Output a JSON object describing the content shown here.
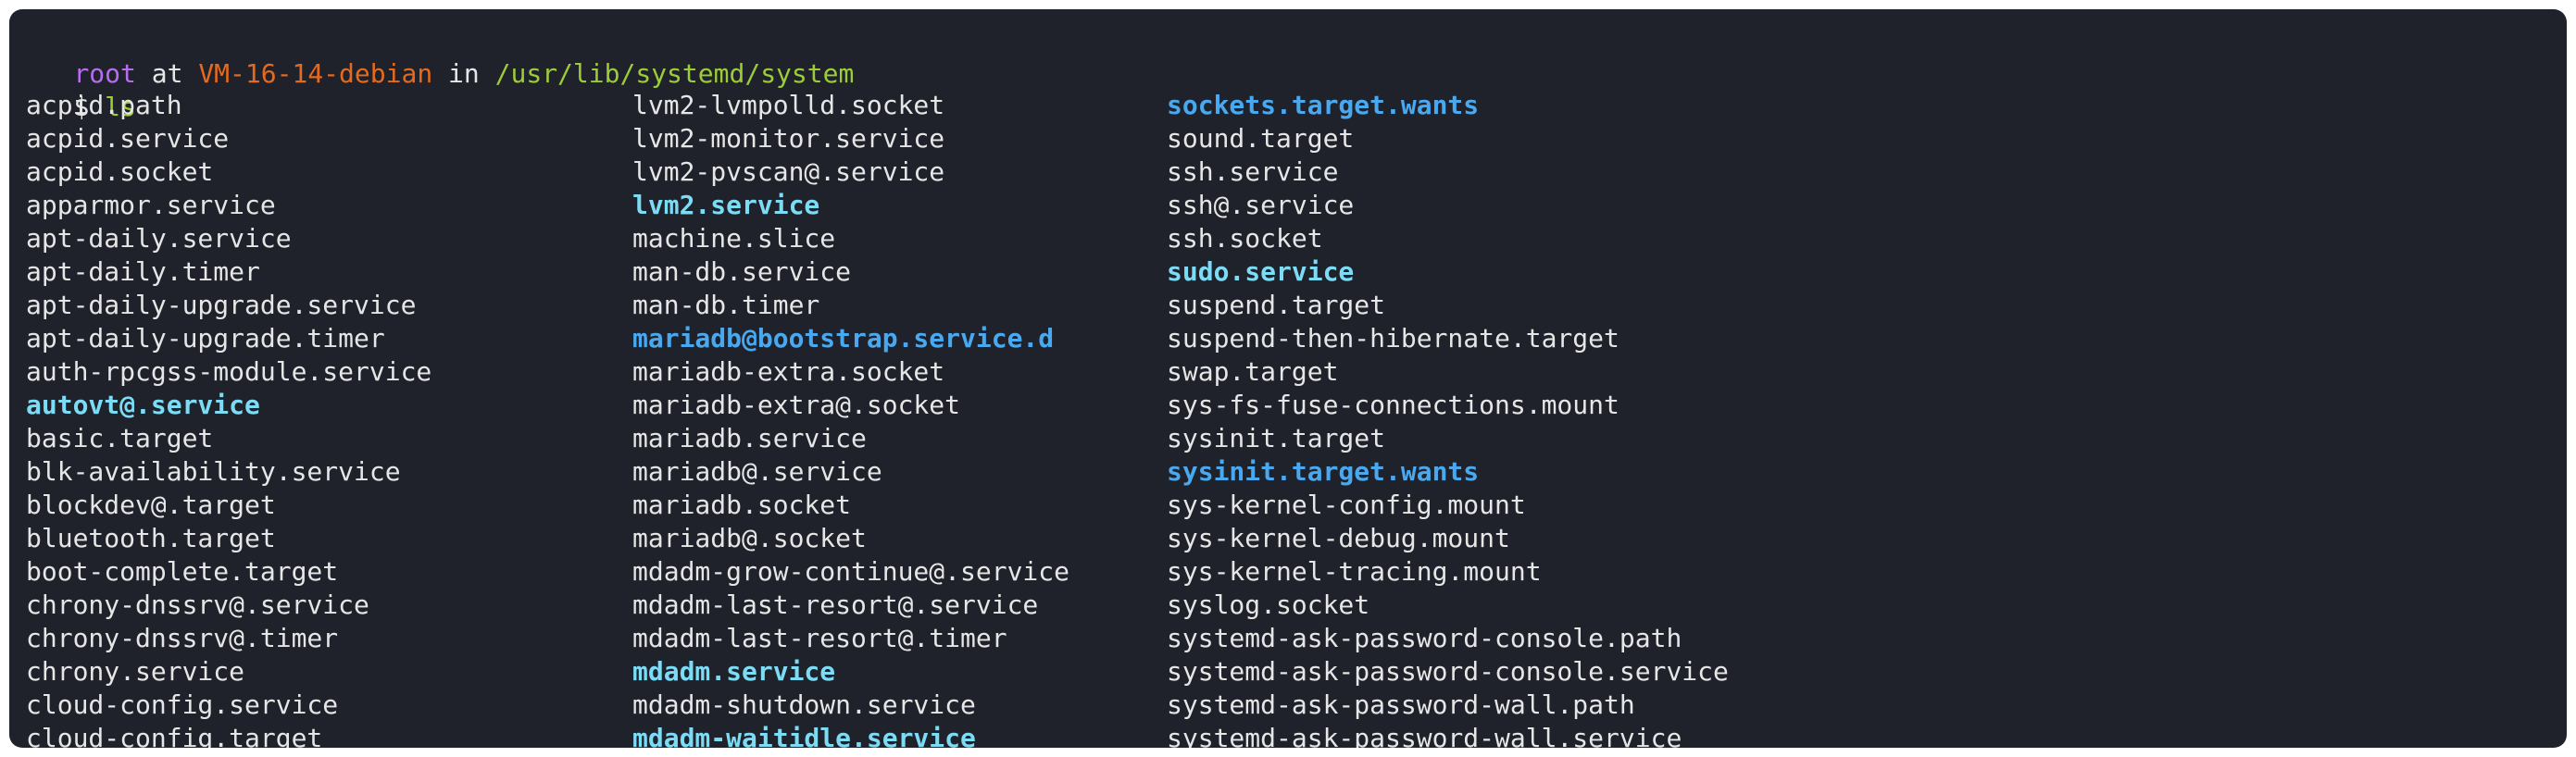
{
  "prompt": {
    "user": "root",
    "at": " at ",
    "host": "VM-16-14-debian",
    "in": " in ",
    "cwd": "/usr/lib/systemd/system",
    "symbol": "$ ",
    "command": "ls"
  },
  "colors": {
    "background": "#1f222b",
    "user": "#b86cf0",
    "host": "#e46a1f",
    "path": "#9ccc38",
    "text": "#e6e6e6",
    "highlight_file": "#7ddcf5",
    "directory": "#49a9f0"
  },
  "listing": {
    "col1": [
      {
        "name": "acpid.path",
        "kind": "file"
      },
      {
        "name": "acpid.service",
        "kind": "file"
      },
      {
        "name": "acpid.socket",
        "kind": "file"
      },
      {
        "name": "apparmor.service",
        "kind": "file"
      },
      {
        "name": "apt-daily.service",
        "kind": "file"
      },
      {
        "name": "apt-daily.timer",
        "kind": "file"
      },
      {
        "name": "apt-daily-upgrade.service",
        "kind": "file"
      },
      {
        "name": "apt-daily-upgrade.timer",
        "kind": "file"
      },
      {
        "name": "auth-rpcgss-module.service",
        "kind": "file"
      },
      {
        "name": "autovt@.service",
        "kind": "link"
      },
      {
        "name": "basic.target",
        "kind": "file"
      },
      {
        "name": "blk-availability.service",
        "kind": "file"
      },
      {
        "name": "blockdev@.target",
        "kind": "file"
      },
      {
        "name": "bluetooth.target",
        "kind": "file"
      },
      {
        "name": "boot-complete.target",
        "kind": "file"
      },
      {
        "name": "chrony-dnssrv@.service",
        "kind": "file"
      },
      {
        "name": "chrony-dnssrv@.timer",
        "kind": "file"
      },
      {
        "name": "chrony.service",
        "kind": "file"
      },
      {
        "name": "cloud-config.service",
        "kind": "file"
      },
      {
        "name": "cloud-config.target",
        "kind": "file"
      }
    ],
    "col2": [
      {
        "name": "lvm2-lvmpolld.socket",
        "kind": "file"
      },
      {
        "name": "lvm2-monitor.service",
        "kind": "file"
      },
      {
        "name": "lvm2-pvscan@.service",
        "kind": "file"
      },
      {
        "name": "lvm2.service",
        "kind": "link"
      },
      {
        "name": "machine.slice",
        "kind": "file"
      },
      {
        "name": "man-db.service",
        "kind": "file"
      },
      {
        "name": "man-db.timer",
        "kind": "file"
      },
      {
        "name": "mariadb@bootstrap.service.d",
        "kind": "dir"
      },
      {
        "name": "mariadb-extra.socket",
        "kind": "file"
      },
      {
        "name": "mariadb-extra@.socket",
        "kind": "file"
      },
      {
        "name": "mariadb.service",
        "kind": "file"
      },
      {
        "name": "mariadb@.service",
        "kind": "file"
      },
      {
        "name": "mariadb.socket",
        "kind": "file"
      },
      {
        "name": "mariadb@.socket",
        "kind": "file"
      },
      {
        "name": "mdadm-grow-continue@.service",
        "kind": "file"
      },
      {
        "name": "mdadm-last-resort@.service",
        "kind": "file"
      },
      {
        "name": "mdadm-last-resort@.timer",
        "kind": "file"
      },
      {
        "name": "mdadm.service",
        "kind": "link"
      },
      {
        "name": "mdadm-shutdown.service",
        "kind": "file"
      },
      {
        "name": "mdadm-waitidle.service",
        "kind": "link"
      }
    ],
    "col3": [
      {
        "name": "sockets.target.wants",
        "kind": "dir"
      },
      {
        "name": "sound.target",
        "kind": "file"
      },
      {
        "name": "ssh.service",
        "kind": "file"
      },
      {
        "name": "ssh@.service",
        "kind": "file"
      },
      {
        "name": "ssh.socket",
        "kind": "file"
      },
      {
        "name": "sudo.service",
        "kind": "link"
      },
      {
        "name": "suspend.target",
        "kind": "file"
      },
      {
        "name": "suspend-then-hibernate.target",
        "kind": "file"
      },
      {
        "name": "swap.target",
        "kind": "file"
      },
      {
        "name": "sys-fs-fuse-connections.mount",
        "kind": "file"
      },
      {
        "name": "sysinit.target",
        "kind": "file"
      },
      {
        "name": "sysinit.target.wants",
        "kind": "dir"
      },
      {
        "name": "sys-kernel-config.mount",
        "kind": "file"
      },
      {
        "name": "sys-kernel-debug.mount",
        "kind": "file"
      },
      {
        "name": "sys-kernel-tracing.mount",
        "kind": "file"
      },
      {
        "name": "syslog.socket",
        "kind": "file"
      },
      {
        "name": "systemd-ask-password-console.path",
        "kind": "file"
      },
      {
        "name": "systemd-ask-password-console.service",
        "kind": "file"
      },
      {
        "name": "systemd-ask-password-wall.path",
        "kind": "file"
      },
      {
        "name": "systemd-ask-password-wall.service",
        "kind": "file"
      }
    ]
  }
}
